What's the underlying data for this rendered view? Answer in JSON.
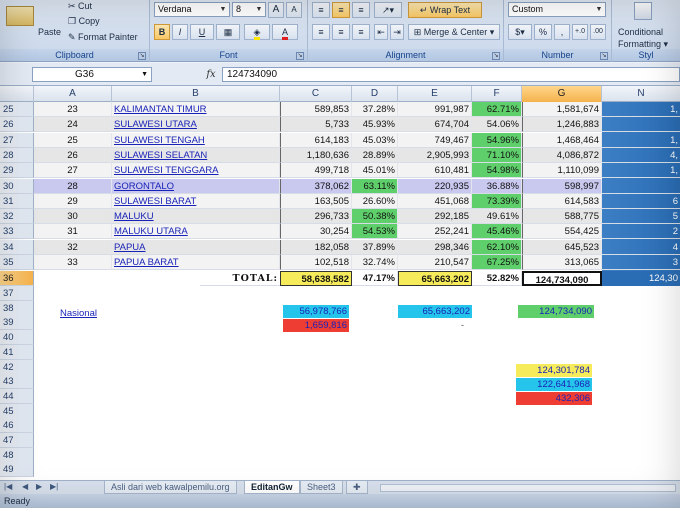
{
  "ribbon": {
    "clipboard": {
      "paste": "Paste",
      "cut": "Cut",
      "copy": "Copy",
      "format_painter": "Format Painter",
      "label": "Clipboard"
    },
    "font": {
      "font_name": "Verdana",
      "font_size": "8",
      "bold": "B",
      "italic": "I",
      "underline": "U",
      "label": "Font"
    },
    "alignment": {
      "wrap_text": "Wrap Text",
      "merge_center": "Merge & Center",
      "label": "Alignment"
    },
    "number": {
      "format": "Custom",
      "currency": "$",
      "percent": "%",
      "comma": ",",
      "label": "Number"
    },
    "styles": {
      "conditional": "Conditional",
      "formatting": "Formatting",
      "label": "Styl"
    }
  },
  "formula_bar": {
    "cell_ref": "G36",
    "fx": "fx",
    "value": "124734090"
  },
  "columns": [
    "A",
    "B",
    "C",
    "D",
    "E",
    "F",
    "G",
    "N"
  ],
  "rows": [
    {
      "row": "25",
      "a": "23",
      "b": "KALIMANTAN TIMUR",
      "c": "589,853",
      "d": "37.28%",
      "e": "991,987",
      "f": "62.71%",
      "g": "1,581,674",
      "n": "1,"
    },
    {
      "row": "26",
      "a": "24",
      "b": "SULAWESI UTARA",
      "c": "5,733",
      "d": "45.93%",
      "e": "674,704",
      "f": "54.06%",
      "g": "1,246,883",
      "n": ""
    },
    {
      "row": "27",
      "a": "25",
      "b": "SULAWESI TENGAH",
      "c": "614,183",
      "d": "45.03%",
      "e": "749,467",
      "f": "54.96%",
      "g": "1,468,464",
      "n": "1,"
    },
    {
      "row": "28",
      "a": "26",
      "b": "SULAWESI SELATAN",
      "c": "1,180,636",
      "d": "28.89%",
      "e": "2,905,993",
      "f": "71.10%",
      "g": "4,086,872",
      "n": "4,"
    },
    {
      "row": "29",
      "a": "27",
      "b": "SULAWESI TENGGARA",
      "c": "499,718",
      "d": "45.01%",
      "e": "610,481",
      "f": "54.98%",
      "g": "1,110,099",
      "n": "1,"
    },
    {
      "row": "30",
      "a": "28",
      "b": "GORONTALO",
      "c": "378,062",
      "d": "63.11%",
      "e": "220,935",
      "f": "36.88%",
      "g": "598,997",
      "n": ""
    },
    {
      "row": "31",
      "a": "29",
      "b": "SULAWESI BARAT",
      "c": "163,505",
      "d": "26.60%",
      "e": "451,068",
      "f": "73.39%",
      "g": "614,583",
      "n": "6"
    },
    {
      "row": "32",
      "a": "30",
      "b": "MALUKU",
      "c": "296,733",
      "d": "50.38%",
      "e": "292,185",
      "f": "49.61%",
      "g": "588,775",
      "n": "5"
    },
    {
      "row": "33",
      "a": "31",
      "b": "MALUKU UTARA",
      "c": "30,254",
      "d": "54.53%",
      "e": "252,241",
      "f": "45.46%",
      "g": "554,425",
      "n": "2"
    },
    {
      "row": "34",
      "a": "32",
      "b": "PAPUA",
      "c": "182,058",
      "d": "37.89%",
      "e": "298,346",
      "f": "62.10%",
      "g": "645,523",
      "n": "4"
    },
    {
      "row": "35",
      "a": "33",
      "b": "PAPUA BARAT",
      "c": "102,518",
      "d": "32.74%",
      "e": "210,547",
      "f": "67.25%",
      "g": "313,065",
      "n": "3"
    }
  ],
  "total": {
    "row": "36",
    "label": "TOTAL:",
    "c": "58,638,582",
    "d": "47.17%",
    "e": "65,663,202",
    "f": "52.82%",
    "g": "124,734,090",
    "n": "124,30"
  },
  "extra": {
    "nasional_label": "Nasional",
    "c38": "56,978,766",
    "c39": "1,659,816",
    "e38": "65,663,202",
    "e39": "-",
    "g38": "124,734,090",
    "g42": "124,301,784",
    "g43": "122,641,968",
    "g44": "432,306"
  },
  "empty_rows": [
    "37",
    "38",
    "39",
    "40",
    "41",
    "42",
    "43",
    "44",
    "45",
    "46",
    "47",
    "48",
    "49"
  ],
  "sheet_tabs": [
    {
      "name": "Asli dari web kawalpemilu.org",
      "active": false
    },
    {
      "name": "EditanGw",
      "active": true
    },
    {
      "name": "Sheet3",
      "active": false
    }
  ],
  "status": "Ready",
  "colors": {
    "green": "#5fcf6b",
    "yellow": "#f6ec5b",
    "cyan": "#25c4ea",
    "red": "#ee3d33",
    "lavender": "#c9c8ef",
    "blue_right": "#3b82c9"
  }
}
